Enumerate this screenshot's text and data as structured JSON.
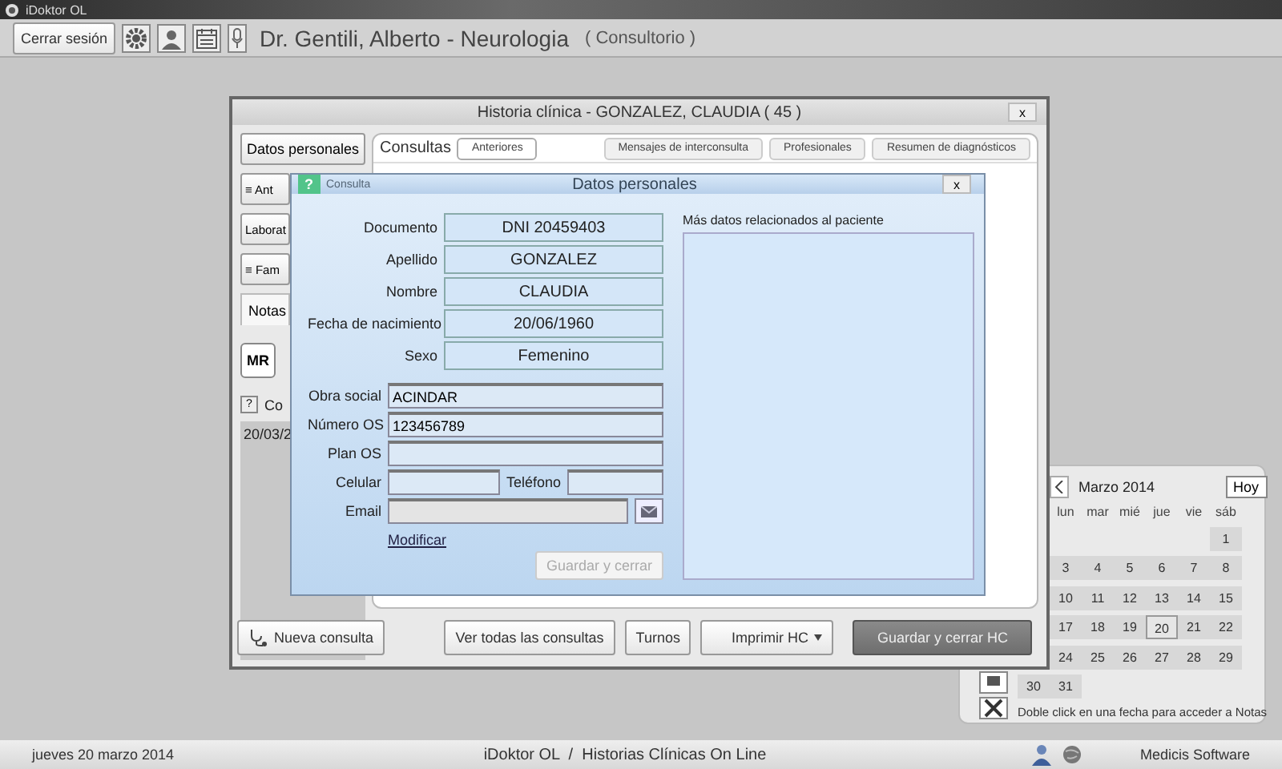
{
  "app": {
    "title": "iDoktor OL"
  },
  "toolbar": {
    "logout": "Cerrar sesión",
    "doctor": "Dr. Gentili, Alberto - Neurologia",
    "place": "( Consultorio )"
  },
  "record": {
    "title": "Historia clínica - GONZALEZ, CLAUDIA ( 45 )",
    "close": "x",
    "side_buttons": [
      {
        "label": "Datos personales"
      },
      {
        "label": "≡ Ant"
      },
      {
        "label": "Laborat"
      },
      {
        "label": "≡ Fam"
      }
    ],
    "notes_tab": "Notas",
    "mr": "MR",
    "help": "?",
    "consult_label": "Co",
    "consult_date": "20/03/2",
    "section": "Consultas",
    "tabs": [
      {
        "label": "Anteriores",
        "selected": true
      }
    ],
    "right_tabs": [
      {
        "label": "Mensajes de interconsulta",
        "selected": false
      },
      {
        "label": "Profesionales",
        "selected": false
      },
      {
        "label": "Resumen de diagnósticos",
        "selected": false
      }
    ],
    "new_consult": "Nueva consulta",
    "buttons": [
      {
        "label": "Ver todas las consultas",
        "kind": "plain"
      },
      {
        "label": "Turnos",
        "kind": "plain"
      },
      {
        "label": "Imprimir HC",
        "kind": "dropdown"
      },
      {
        "label": "Guardar y cerrar HC",
        "kind": "primary"
      }
    ]
  },
  "dialog": {
    "title": "Datos personales",
    "help": "?",
    "hint": "Consulta",
    "close": "x",
    "main_fields": [
      {
        "label": "Documento",
        "value": "DNI 20459403"
      },
      {
        "label": "Apellido",
        "value": "GONZALEZ"
      },
      {
        "label": "Nombre",
        "value": "CLAUDIA"
      },
      {
        "label": "Fecha de nacimiento",
        "value": "20/06/1960"
      },
      {
        "label": "Sexo",
        "value": "Femenino"
      }
    ],
    "fields": [
      {
        "label": "Obra social",
        "value": "ACINDAR"
      },
      {
        "label": "Número OS",
        "value": "123456789"
      },
      {
        "label": "Plan OS"
      }
    ],
    "mobile_label": "Celular",
    "phone_label": "Teléfono",
    "email_label": "Email",
    "modify_link": "Modificar",
    "save": {
      "label": "Guardar y cerrar",
      "disabled": true
    },
    "notes_label": "Más datos relacionados al paciente"
  },
  "calendar": {
    "month": "Marzo 2014",
    "today": "Hoy",
    "weekdays": [
      {
        "kind": "blank"
      },
      {
        "kind": "label",
        "label": "lun"
      },
      {
        "kind": "label",
        "label": "mar"
      },
      {
        "kind": "label",
        "label": "mié"
      },
      {
        "kind": "label",
        "label": "jue"
      },
      {
        "kind": "label",
        "label": "vie"
      },
      {
        "kind": "label",
        "label": "sáb"
      }
    ],
    "weeks": [
      [
        {
          "kind": "blank"
        },
        {
          "kind": "blank"
        },
        {
          "kind": "blank"
        },
        {
          "kind": "blank"
        },
        {
          "kind": "blank"
        },
        {
          "kind": "blank"
        },
        {
          "kind": "day",
          "day": "1",
          "selected": false
        }
      ],
      [
        {
          "kind": "blank"
        },
        {
          "kind": "day",
          "day": "3",
          "selected": false
        },
        {
          "kind": "day",
          "day": "4",
          "selected": false
        },
        {
          "kind": "day",
          "day": "5",
          "selected": false
        },
        {
          "kind": "day",
          "day": "6",
          "selected": false
        },
        {
          "kind": "day",
          "day": "7",
          "selected": false
        },
        {
          "kind": "day",
          "day": "8",
          "selected": false
        }
      ],
      [
        {
          "kind": "blank"
        },
        {
          "kind": "day",
          "day": "10",
          "selected": false
        },
        {
          "kind": "day",
          "day": "11",
          "selected": false
        },
        {
          "kind": "day",
          "day": "12",
          "selected": false
        },
        {
          "kind": "day",
          "day": "13",
          "selected": false
        },
        {
          "kind": "day",
          "day": "14",
          "selected": false
        },
        {
          "kind": "day",
          "day": "15",
          "selected": false
        }
      ],
      [
        {
          "kind": "blank"
        },
        {
          "kind": "day",
          "day": "17",
          "selected": false
        },
        {
          "kind": "day",
          "day": "18",
          "selected": false
        },
        {
          "kind": "day",
          "day": "19",
          "selected": false
        },
        {
          "kind": "day",
          "day": "20",
          "selected": true
        },
        {
          "kind": "day",
          "day": "21",
          "selected": false
        },
        {
          "kind": "day",
          "day": "22",
          "selected": false
        }
      ],
      [
        {
          "kind": "blank"
        },
        {
          "kind": "day",
          "day": "24",
          "selected": false
        },
        {
          "kind": "day",
          "day": "25",
          "selected": false
        },
        {
          "kind": "day",
          "day": "26",
          "selected": false
        },
        {
          "kind": "day",
          "day": "27",
          "selected": false
        },
        {
          "kind": "day",
          "day": "28",
          "selected": false
        },
        {
          "kind": "day",
          "day": "29",
          "selected": false
        }
      ],
      [
        {
          "kind": "day",
          "day": "30",
          "selected": false
        },
        {
          "kind": "day",
          "day": "31",
          "selected": false
        },
        {
          "kind": "blank"
        },
        {
          "kind": "blank"
        },
        {
          "kind": "blank"
        },
        {
          "kind": "blank"
        },
        {
          "kind": "blank"
        }
      ]
    ],
    "hint": "Doble click en una fecha para acceder a Notas"
  },
  "status": {
    "date": "jueves 20 marzo 2014",
    "product": "iDoktor OL  /  Historias Clínicas On Line",
    "vendor": "Medicis Software"
  }
}
